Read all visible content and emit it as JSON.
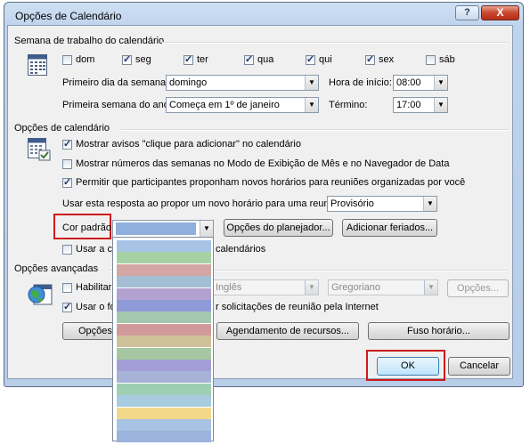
{
  "window": {
    "title": "Opções de Calendário",
    "help_label": "?",
    "close_label": "X"
  },
  "work_week": {
    "section_title": "Semana de trabalho do calendário",
    "days": [
      {
        "label": "dom",
        "checked": false
      },
      {
        "label": "seg",
        "checked": true
      },
      {
        "label": "ter",
        "checked": true
      },
      {
        "label": "qua",
        "checked": true
      },
      {
        "label": "qui",
        "checked": true
      },
      {
        "label": "sex",
        "checked": true
      },
      {
        "label": "sáb",
        "checked": false
      }
    ],
    "first_day_label": "Primeiro dia da semana:",
    "first_day_value": "domingo",
    "first_week_label": "Primeira semana do ano:",
    "first_week_value": "Começa em 1º de janeiro",
    "start_time_label": "Hora de início:",
    "start_time_value": "08:00",
    "end_time_label": "Término:",
    "end_time_value": "17:00"
  },
  "calendar_options": {
    "section_title": "Opções de calendário",
    "show_click_to_add": {
      "label": "Mostrar avisos \"clique para adicionar\" no calendário",
      "checked": true
    },
    "show_week_numbers": {
      "label": "Mostrar números das semanas no Modo de Exibição de Mês e no Navegador de Data",
      "checked": false
    },
    "allow_propose": {
      "label": "Permitir que participantes proponham novos horários para reuniões organizadas por você",
      "checked": true
    },
    "response_label": "Usar esta resposta ao propor um novo horário para uma reunião:",
    "response_value": "Provisório",
    "default_color_label": "Cor padrão:",
    "planner_button": "Opções do planejador...",
    "add_holidays_button": "Adicionar feriados...",
    "use_color_label_start": "Usar a co",
    "use_color_label_end": "calendários"
  },
  "advanced": {
    "section_title": "Opções avançadas",
    "enable_label_start": "Habilitar",
    "language_value": "Inglês",
    "calendar_type_value": "Gregoriano",
    "options_button": "Opções...",
    "use_fo_label_start": "Usar o fo",
    "use_fo_label_end": "r solicitações de reunião pela Internet",
    "button_partial": "Opções c",
    "resource_scheduling_button": "Agendamento de recursos...",
    "time_zone_button": "Fuso horário..."
  },
  "footer": {
    "ok_label": "OK",
    "cancel_label": "Cancelar"
  },
  "color_dropdown": {
    "selected_color": "#8fafdc",
    "colors": [
      "#a7c3e6",
      "#a6d1a3",
      "#d4a6a3",
      "#a3bdd3",
      "#b2a2cf",
      "#8f9ad8",
      "#a4c8ad",
      "#d09a9a",
      "#cfc19a",
      "#a6c7a1",
      "#a39fd6",
      "#a6b3d7",
      "#9fcfb3",
      "#a8cbe0",
      "#f2d98a",
      "#a8c3e3",
      "#9bb3dd"
    ]
  },
  "colors": {
    "accent_red": "#cc1a1a",
    "title_gradient_top": "#cfe0f3",
    "client_bg": "#f0f0f0"
  }
}
